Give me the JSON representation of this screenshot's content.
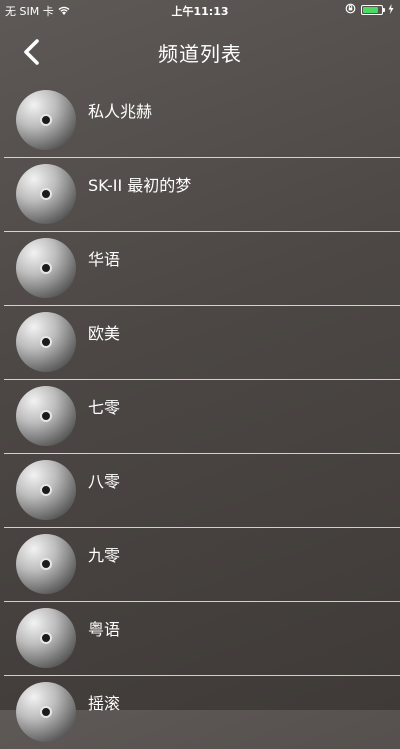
{
  "status_bar": {
    "carrier": "无 SIM 卡",
    "wifi_icon": "wifi-icon",
    "time": "上午11:13",
    "lock_icon": "orientation-lock-icon",
    "battery_icon": "battery-icon",
    "battery_level": 0.85,
    "charging_icon": "charging-icon",
    "battery_color": "#4cd964"
  },
  "nav": {
    "back_icon": "chevron-left-icon",
    "title": "频道列表"
  },
  "channels": [
    {
      "label": "私人兆赫"
    },
    {
      "label": "SK-II 最初的梦"
    },
    {
      "label": "华语"
    },
    {
      "label": "欧美"
    },
    {
      "label": "七零"
    },
    {
      "label": "八零"
    },
    {
      "label": "九零"
    },
    {
      "label": "粤语"
    },
    {
      "label": "摇滚"
    }
  ]
}
